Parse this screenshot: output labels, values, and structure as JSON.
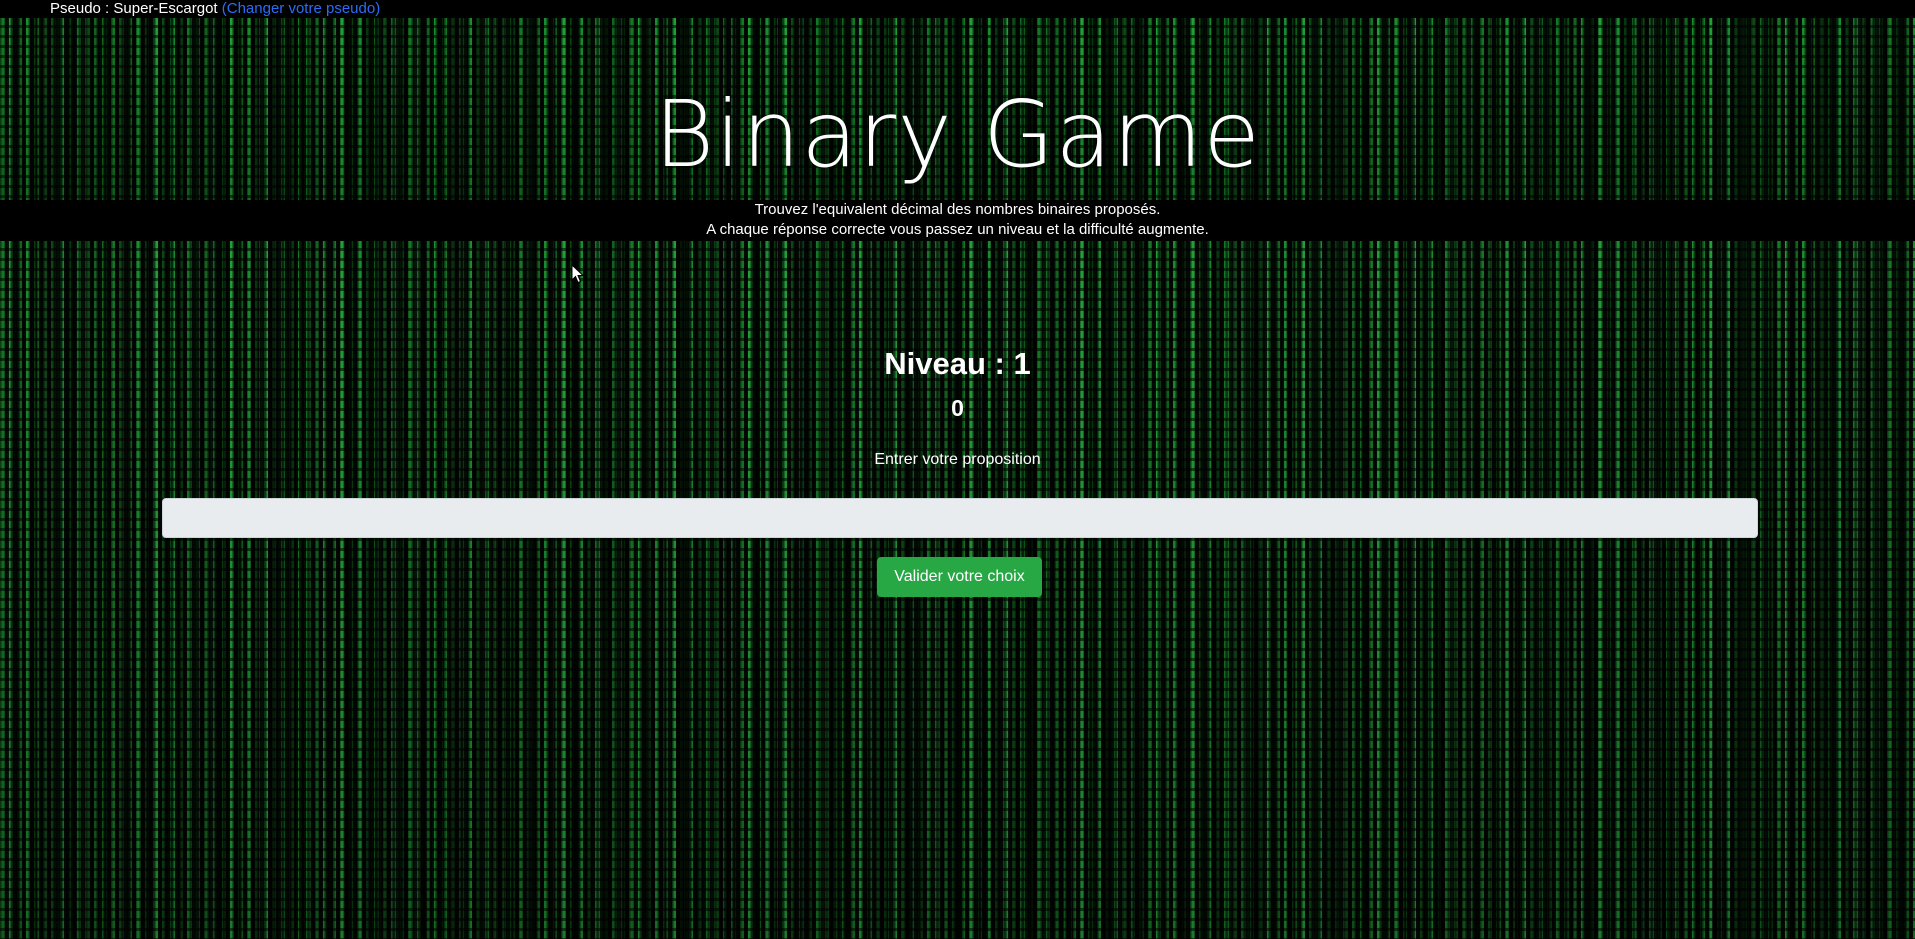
{
  "header": {
    "pseudo_text": "Pseudo : Super-Escargot",
    "change_pseudo_link": "(Changer votre pseudo)"
  },
  "game": {
    "title": "Binary Game",
    "intro_line1": "Trouvez l'equivalent décimal des nombres binaires proposés.",
    "intro_line2": "A chaque réponse correcte vous passez un niveau et la difficulté augmente.",
    "level_label": "Niveau : 1",
    "binary_number": "0",
    "prompt_label": "Entrer votre proposition",
    "answer_value": "",
    "answer_placeholder": "",
    "validate_button": "Valider votre choix"
  },
  "colors": {
    "background": "#000000",
    "matrix_green": "#1c9e2f",
    "link": "#2b6ef5",
    "button_green": "#28a745",
    "input_bg": "#e9ecef"
  },
  "icons": {
    "cursor": "mouse-pointer-icon"
  }
}
